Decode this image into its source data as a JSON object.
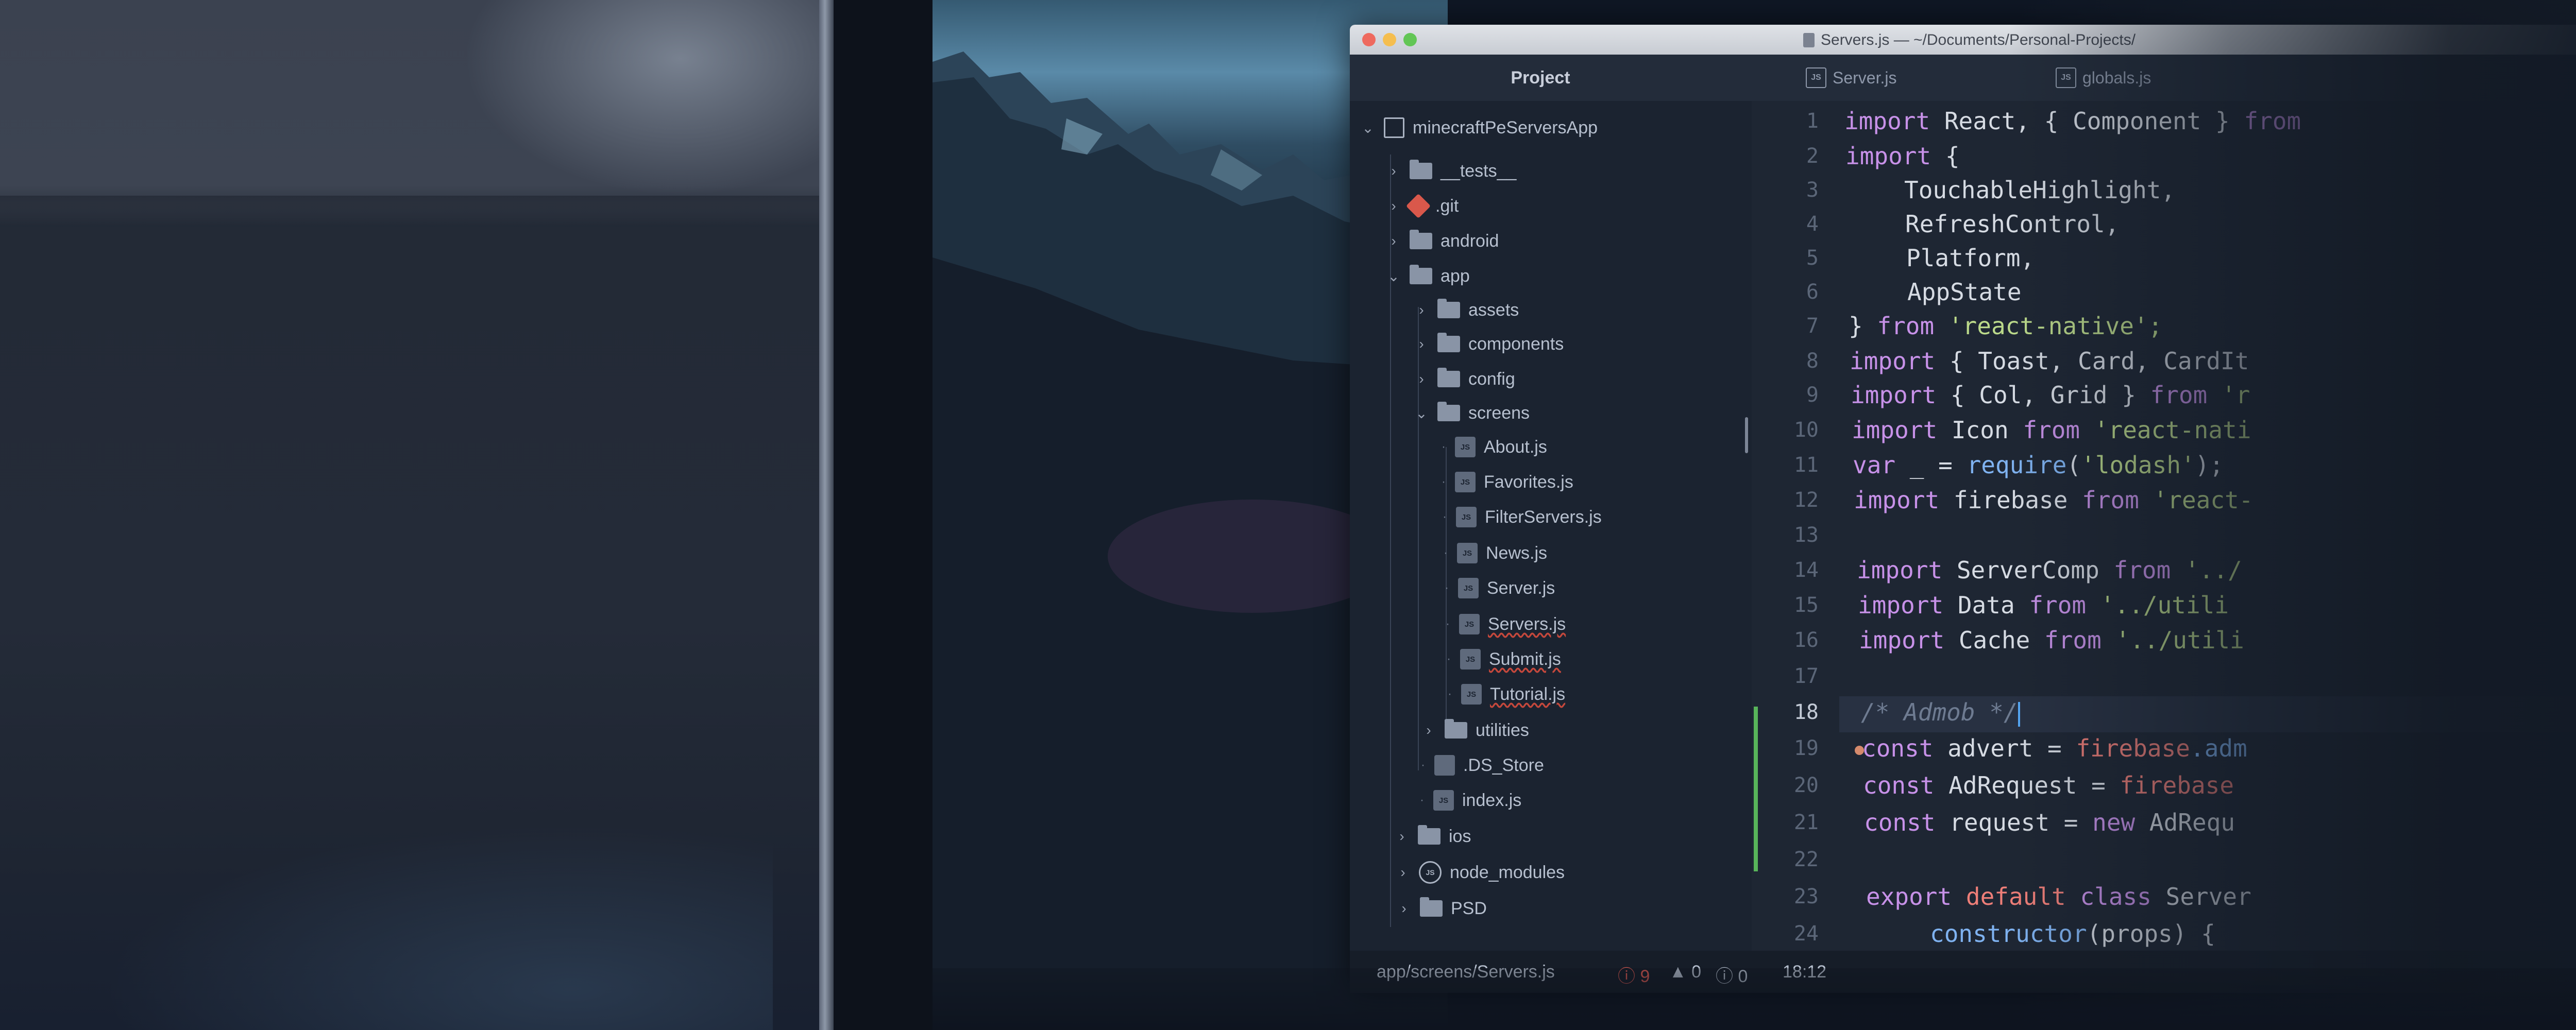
{
  "window": {
    "title": "Servers.js — ~/Documents/Personal-Projects/"
  },
  "tabs": {
    "project": "Project",
    "files": [
      "Server.js",
      "globals.js"
    ],
    "file_icon": "JS"
  },
  "tree": {
    "root": "minecraftPeServersApp",
    "items": [
      {
        "label": "__tests__",
        "icon": "folder-icon"
      },
      {
        "label": ".git",
        "icon": "git-icon"
      },
      {
        "label": "android",
        "icon": "folder-icon"
      },
      {
        "label": "app",
        "icon": "folder-icon"
      },
      {
        "label": "assets",
        "icon": "folder-icon"
      },
      {
        "label": "components",
        "icon": "folder-icon"
      },
      {
        "label": "config",
        "icon": "folder-icon"
      },
      {
        "label": "screens",
        "icon": "folder-icon"
      },
      {
        "label": "About.js",
        "icon": "js-file-icon"
      },
      {
        "label": "Favorites.js",
        "icon": "js-file-icon"
      },
      {
        "label": "FilterServers.js",
        "icon": "js-file-icon"
      },
      {
        "label": "News.js",
        "icon": "js-file-icon"
      },
      {
        "label": "Server.js",
        "icon": "js-file-icon"
      },
      {
        "label": "Servers.js",
        "icon": "js-file-icon"
      },
      {
        "label": "Submit.js",
        "icon": "js-file-icon"
      },
      {
        "label": "Tutorial.js",
        "icon": "js-file-icon"
      },
      {
        "label": "utilities",
        "icon": "folder-icon"
      },
      {
        "label": ".DS_Store",
        "icon": "file-icon"
      },
      {
        "label": "index.js",
        "icon": "js-file-icon"
      },
      {
        "label": "ios",
        "icon": "folder-icon"
      },
      {
        "label": "node_modules",
        "icon": "node-icon"
      },
      {
        "label": "PSD",
        "icon": "folder-icon"
      }
    ]
  },
  "line_numbers": [
    "1",
    "2",
    "3",
    "4",
    "5",
    "6",
    "7",
    "8",
    "9",
    "10",
    "11",
    "12",
    "13",
    "14",
    "15",
    "16",
    "17",
    "18",
    "19",
    "20",
    "21",
    "22",
    "23",
    "24"
  ],
  "code": {
    "l1a": "import",
    "l1b": " React, { Component } ",
    "l1c": "from",
    "l2a": "import",
    "l2b": " {",
    "l3": "TouchableHighlight,",
    "l4": "RefreshControl,",
    "l5": "Platform,",
    "l6": "AppState",
    "l7a": "} ",
    "l7b": "from",
    "l7c": " 'react-native';",
    "l8a": "import",
    "l8b": " { Toast, Card, CardIt",
    "l9a": "import",
    "l9b": " { Col, Grid } ",
    "l9c": "from",
    "l9d": " 'r",
    "l10a": "import",
    "l10b": " Icon ",
    "l10c": "from",
    "l10d": " 'react-nati",
    "l11a": "var",
    "l11b": " _ = ",
    "l11c": "require",
    "l11d": "(",
    "l11e": "'lodash'",
    "l11f": ");",
    "l12a": "import",
    "l12b": " firebase ",
    "l12c": "from",
    "l12d": " 'react-",
    "l14a": "import",
    "l14b": " ServerComp ",
    "l14c": "from",
    "l14d": " '../",
    "l15a": "import",
    "l15b": " Data ",
    "l15c": "from",
    "l15d": " '../utili",
    "l16a": "import",
    "l16b": " Cache ",
    "l16c": "from",
    "l16d": " '../utili",
    "l18": "/* Admob */",
    "l19a": "const",
    "l19b": " advert = ",
    "l19c": "firebase",
    "l19d": ".adm",
    "l20a": "const",
    "l20b": " AdRequest = ",
    "l20c": "firebase",
    "l21a": "const",
    "l21b": " request = ",
    "l21c": "new",
    "l21d": " AdRequ",
    "l23a": "export",
    "l23b": " ",
    "l23c": "default",
    "l23d": " ",
    "l23e": "class",
    "l23f": " Server",
    "l24a": "constructor",
    "l24b": "(props) {"
  },
  "statusbar": {
    "path": "app/screens/Servers.js",
    "errors": "9",
    "warnings": "0",
    "infos": "0",
    "cursor": "18:12"
  },
  "colors": {
    "keyword": "#c791e8",
    "string": "#bbd98a",
    "function": "#7fb2f0",
    "variable": "#ee7e78",
    "error": "#e05b52"
  }
}
